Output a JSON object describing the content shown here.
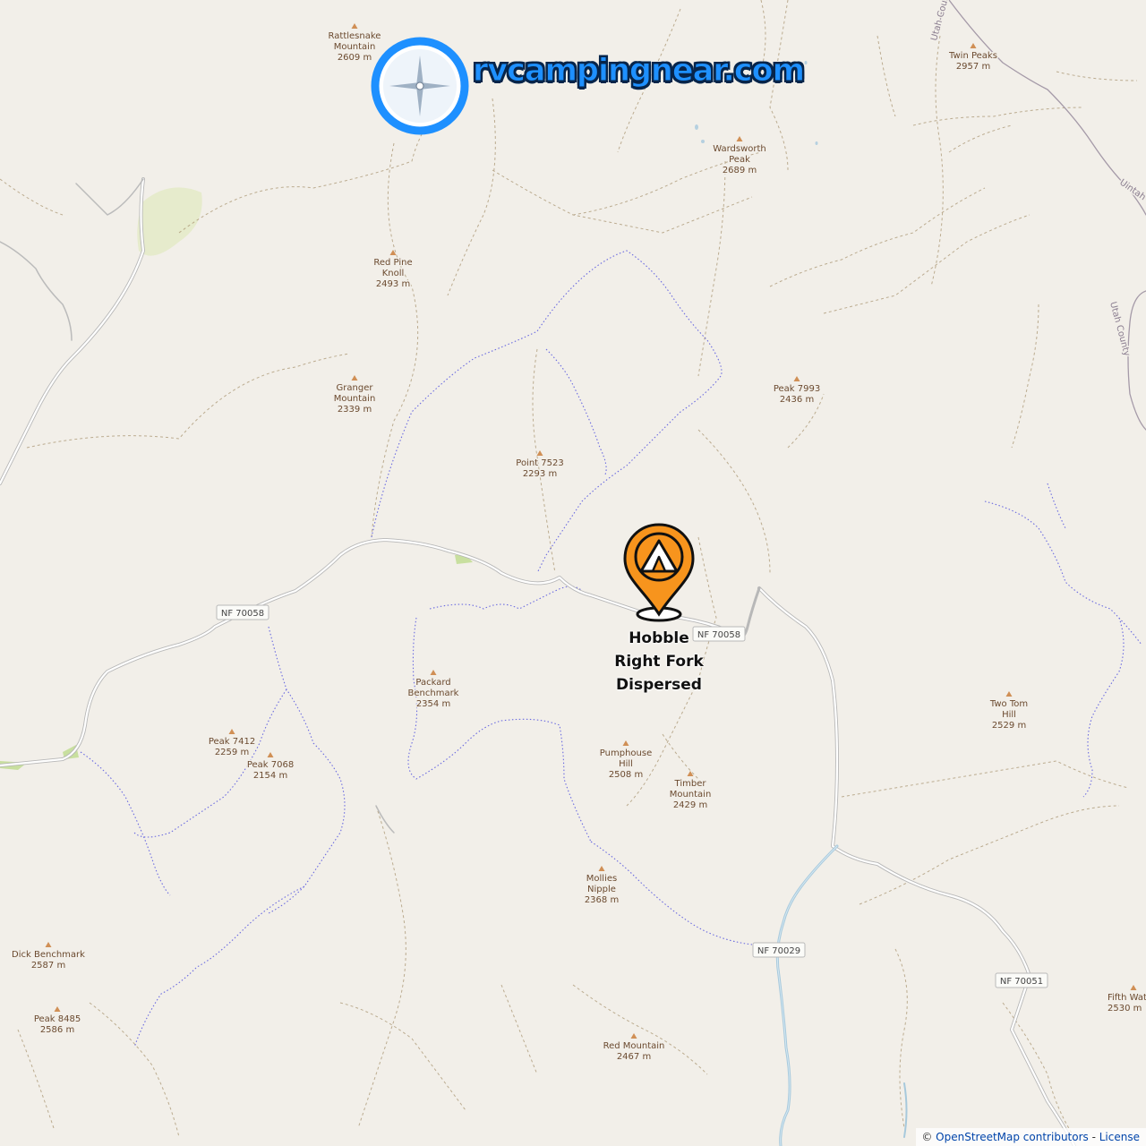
{
  "brand": {
    "text": "rvcampingnear.com",
    "logo_icon": "compass-icon"
  },
  "campsite": {
    "name": "Hobble Right Fork Dispersed",
    "icon": "tent-marker-icon",
    "color": "#f7941d"
  },
  "peaks": [
    {
      "name": "Rattlesnake Mountain",
      "lines": [
        "Rattlesnake",
        "Mountain"
      ],
      "elevation": "2609 m"
    },
    {
      "name": "Twin Peaks",
      "lines": [
        "Twin Peaks"
      ],
      "elevation": "2957 m"
    },
    {
      "name": "Wardsworth Peak",
      "lines": [
        "Wardsworth",
        "Peak"
      ],
      "elevation": "2689 m"
    },
    {
      "name": "Red Pine Knoll",
      "lines": [
        "Red Pine",
        "Knoll"
      ],
      "elevation": "2493 m"
    },
    {
      "name": "Granger Mountain",
      "lines": [
        "Granger",
        "Mountain"
      ],
      "elevation": "2339 m"
    },
    {
      "name": "Peak 7993",
      "lines": [
        "Peak 7993"
      ],
      "elevation": "2436 m"
    },
    {
      "name": "Point 7523",
      "lines": [
        "Point 7523"
      ],
      "elevation": "2293 m"
    },
    {
      "name": "Packard Benchmark",
      "lines": [
        "Packard",
        "Benchmark"
      ],
      "elevation": "2354 m"
    },
    {
      "name": "Peak 7412",
      "lines": [
        "Peak 7412"
      ],
      "elevation": "2259 m"
    },
    {
      "name": "Peak 7068",
      "lines": [
        "Peak 7068"
      ],
      "elevation": "2154 m"
    },
    {
      "name": "Two Tom Hill",
      "lines": [
        "Two Tom",
        "Hill"
      ],
      "elevation": "2529 m"
    },
    {
      "name": "Pumphouse Hill",
      "lines": [
        "Pumphouse",
        "Hill"
      ],
      "elevation": "2508 m"
    },
    {
      "name": "Timber Mountain",
      "lines": [
        "Timber",
        "Mountain"
      ],
      "elevation": "2429 m"
    },
    {
      "name": "Mollies Nipple",
      "lines": [
        "Mollies",
        "Nipple"
      ],
      "elevation": "2368 m"
    },
    {
      "name": "Dick Benchmark",
      "lines": [
        "Dick Benchmark"
      ],
      "elevation": "2587 m"
    },
    {
      "name": "Peak 8485",
      "lines": [
        "Peak 8485"
      ],
      "elevation": "2586 m"
    },
    {
      "name": "Red Mountain",
      "lines": [
        "Red Mountain"
      ],
      "elevation": "2467 m"
    },
    {
      "name": "Fifth Water",
      "lines": [
        "Fifth Wat"
      ],
      "elevation": "2530 m"
    }
  ],
  "road_labels": [
    "NF 70058",
    "NF 70058",
    "NF 70029",
    "NF 70051"
  ],
  "admin_labels": [
    "Utah Coun",
    "Uintah",
    "Utah County"
  ],
  "attribution": {
    "prefix": "© ",
    "osm": "OpenStreetMap contributors",
    "separator": " - ",
    "license": "License"
  },
  "colors": {
    "background": "#f2efe9",
    "trail": "#a08a6a",
    "path": "#5a5ad8",
    "road": "#b5b5b5",
    "river": "#9cc3d8",
    "peak": "#d08f55",
    "brand": "#1e90ff",
    "marker": "#f7941d"
  }
}
